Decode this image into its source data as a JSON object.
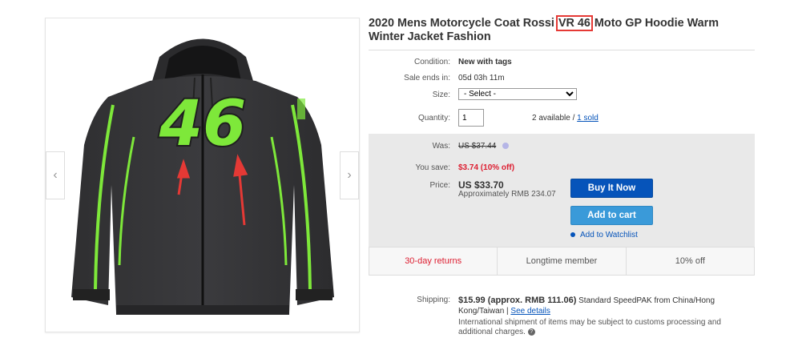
{
  "product": {
    "title_before": "2020 Mens Motorcycle Coat Rossi ",
    "title_highlight": "VR 46",
    "title_after": " Moto GP Hoodie Warm Winter Jacket Fashion"
  },
  "details": {
    "condition_label": "Condition:",
    "condition_value": "New with tags",
    "sale_ends_label": "Sale ends in:",
    "sale_ends_value": "05d 03h 11m",
    "size_label": "Size:",
    "size_selected": "- Select -",
    "quantity_label": "Quantity:",
    "quantity_value": "1",
    "available_text": "2 available / ",
    "sold_link": "1 sold"
  },
  "pricing": {
    "was_label": "Was:",
    "was_value": "US $37.44",
    "save_label": "You save:",
    "save_value": "$3.74 (10% off)",
    "price_label": "Price:",
    "price_value": "US $33.70",
    "approx_value": "Approximately RMB 234.07",
    "buy_now_label": "Buy It Now",
    "add_to_cart_label": "Add to cart",
    "watchlist_label": "Add to Watchlist"
  },
  "badges": {
    "returns": "30-day returns",
    "member": "Longtime member",
    "discount": "10% off"
  },
  "shipping": {
    "label": "Shipping:",
    "cost": "$15.99 (approx. RMB 111.06)",
    "method": " Standard SpeedPAK from China/Hong Kong/Taiwan | ",
    "details_link": "See details",
    "note": "International shipment of items may be subject to customs processing and additional charges."
  },
  "gallery": {
    "prev_glyph": "‹",
    "next_glyph": "›",
    "jacket_number": "46"
  },
  "colors": {
    "accent_blue": "#0654ba",
    "cart_blue": "#3a9ad9",
    "sale_red": "#dd1e31",
    "highlight_red": "#e53935",
    "jacket_green": "#7ee83a"
  }
}
